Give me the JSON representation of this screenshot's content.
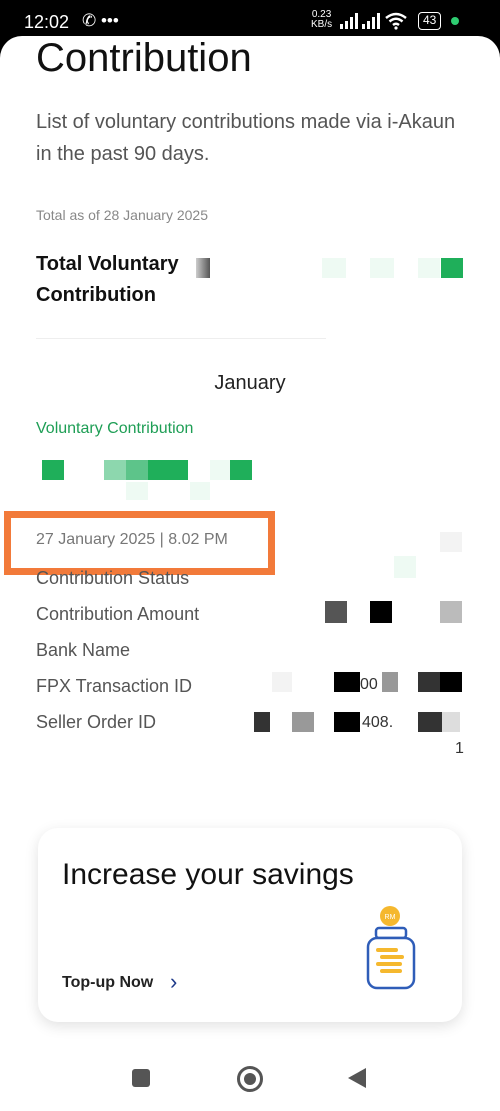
{
  "status_bar": {
    "time": "12:02",
    "left_icons": "✆ •••",
    "speed_value": "0.23",
    "speed_unit": "KB/s",
    "battery": "43"
  },
  "page": {
    "title": "Contribution",
    "subtitle": "List of voluntary contributions made via i-Akaun in the past 90 days.",
    "as_of": "Total as of 28 January 2025",
    "total_label": "Total Voluntary Contribution",
    "month": "January",
    "vc_label": "Voluntary Contribution",
    "date": "27 January 2025  |  8.02 PM"
  },
  "details": {
    "status_label": "Contribution Status",
    "amount_label": "Contribution Amount",
    "bank_label": "Bank Name",
    "fpx_label": "FPX Transaction ID",
    "fpx_value_fragment": "00",
    "seller_label": "Seller Order ID",
    "seller_value_fragment": "408.",
    "seller_value_tail": "1"
  },
  "card": {
    "title": "Increase your savings",
    "link": "Top-up Now",
    "chevron": "›",
    "jar_badge": "RM"
  },
  "colors": {
    "accent_green": "#1e9e55",
    "highlight_orange": "#f27a3a",
    "link_blue": "#1e3a8a"
  }
}
